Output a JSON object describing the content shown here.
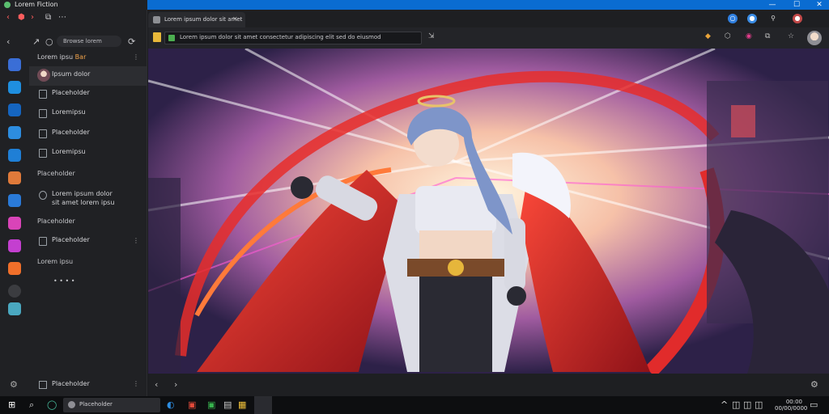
{
  "titlebar": {
    "app_title": "Lorem Fiction",
    "min_label": "—",
    "max_label": "☐",
    "close_label": "✕"
  },
  "sidebar": {
    "nav_pill": "Browse lorem",
    "group_head_prefix": "Lorem ipsu",
    "group_head_accent": "Bar",
    "menu_glyph": "⋮",
    "items": [
      {
        "label": "Ipsum dolor"
      },
      {
        "label": "Placeholder"
      },
      {
        "label": "Loremipsu"
      },
      {
        "label": "Placeholder"
      },
      {
        "label": "Loremipsu"
      },
      {
        "label": "Placeholder"
      }
    ],
    "sub_head_1": "Placeholder",
    "twoline": "Lorem ipsum dolor\nsit amet lorem ipsu",
    "sub_head_2": "Placeholder",
    "item_7": "Placeholder",
    "sub_head_3": "Lorem ipsu",
    "sub_head_4": "• • • •",
    "bottom_label": "Placeholder"
  },
  "tab": {
    "title": "Lorem ipsum dolor sit amet",
    "close": "✕"
  },
  "urlbar": {
    "url": "Lorem ipsum dolor sit amet consectetur adipiscing elit sed do eiusmod"
  },
  "taskbar": {
    "search_text": "Placeholder",
    "time": "00:00",
    "date": "00/00/0000"
  },
  "colors": {
    "accent": "#0a6cd1",
    "sidebar_bg": "#202124",
    "main_bg": "#17181b"
  }
}
